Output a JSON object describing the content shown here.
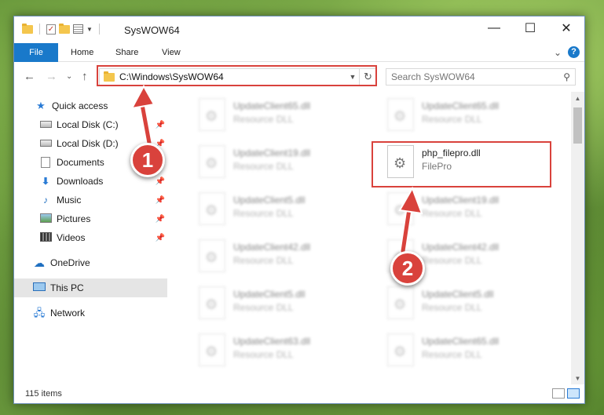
{
  "window": {
    "title": "SysWOW64",
    "controls": {
      "minimize": "—",
      "maximize": "☐",
      "close": "✕"
    }
  },
  "ribbon": {
    "tabs": [
      "File",
      "Home",
      "Share",
      "View"
    ],
    "expand": "⌄",
    "help": "?"
  },
  "nav": {
    "back": "←",
    "forward": "→",
    "recent": "⌄",
    "up": "↑",
    "address": "C:\\Windows\\SysWOW64",
    "refresh": "↻"
  },
  "search": {
    "placeholder": "Search SysWOW64",
    "icon": "search-icon"
  },
  "sidebar": {
    "items": [
      {
        "label": "Quick access",
        "icon": "star-icon"
      },
      {
        "label": "Local Disk (C:)",
        "icon": "disk-icon",
        "pinned": true
      },
      {
        "label": "Local Disk (D:)",
        "icon": "disk-icon",
        "pinned": true
      },
      {
        "label": "Documents",
        "icon": "document-icon",
        "pinned": true
      },
      {
        "label": "Downloads",
        "icon": "download-icon",
        "pinned": true
      },
      {
        "label": "Music",
        "icon": "music-icon",
        "pinned": true
      },
      {
        "label": "Pictures",
        "icon": "pictures-icon",
        "pinned": true
      },
      {
        "label": "Videos",
        "icon": "videos-icon",
        "pinned": true
      },
      {
        "label": "OneDrive",
        "icon": "cloud-icon"
      },
      {
        "label": "This PC",
        "icon": "computer-icon",
        "selected": true
      },
      {
        "label": "Network",
        "icon": "network-icon"
      }
    ]
  },
  "files": [
    {
      "name": "UpdateClient65.dll",
      "type": "Resource DLL"
    },
    {
      "name": "UpdateClient65.dll",
      "type": "Resource DLL"
    },
    {
      "name": "UpdateClient19.dll",
      "type": "Resource DLL"
    },
    {
      "name": "php_filepro.dll",
      "type": "FilePro"
    },
    {
      "name": "UpdateClient5.dll",
      "type": "Resource DLL"
    },
    {
      "name": "UpdateClient19.dll",
      "type": "Resource DLL"
    },
    {
      "name": "UpdateClient42.dll",
      "type": "Resource DLL"
    },
    {
      "name": "UpdateClient42.dll",
      "type": "Resource DLL"
    },
    {
      "name": "UpdateClient5.dll",
      "type": "Resource DLL"
    },
    {
      "name": "UpdateClient5.dll",
      "type": "Resource DLL"
    },
    {
      "name": "UpdateClient63.dll",
      "type": "Resource DLL"
    },
    {
      "name": "UpdateClient65.dll",
      "type": "Resource DLL"
    }
  ],
  "status": {
    "count": "115 items"
  },
  "callouts": {
    "one": "1",
    "two": "2"
  },
  "colors": {
    "accent": "#1979ca",
    "highlight": "#d9423c"
  }
}
